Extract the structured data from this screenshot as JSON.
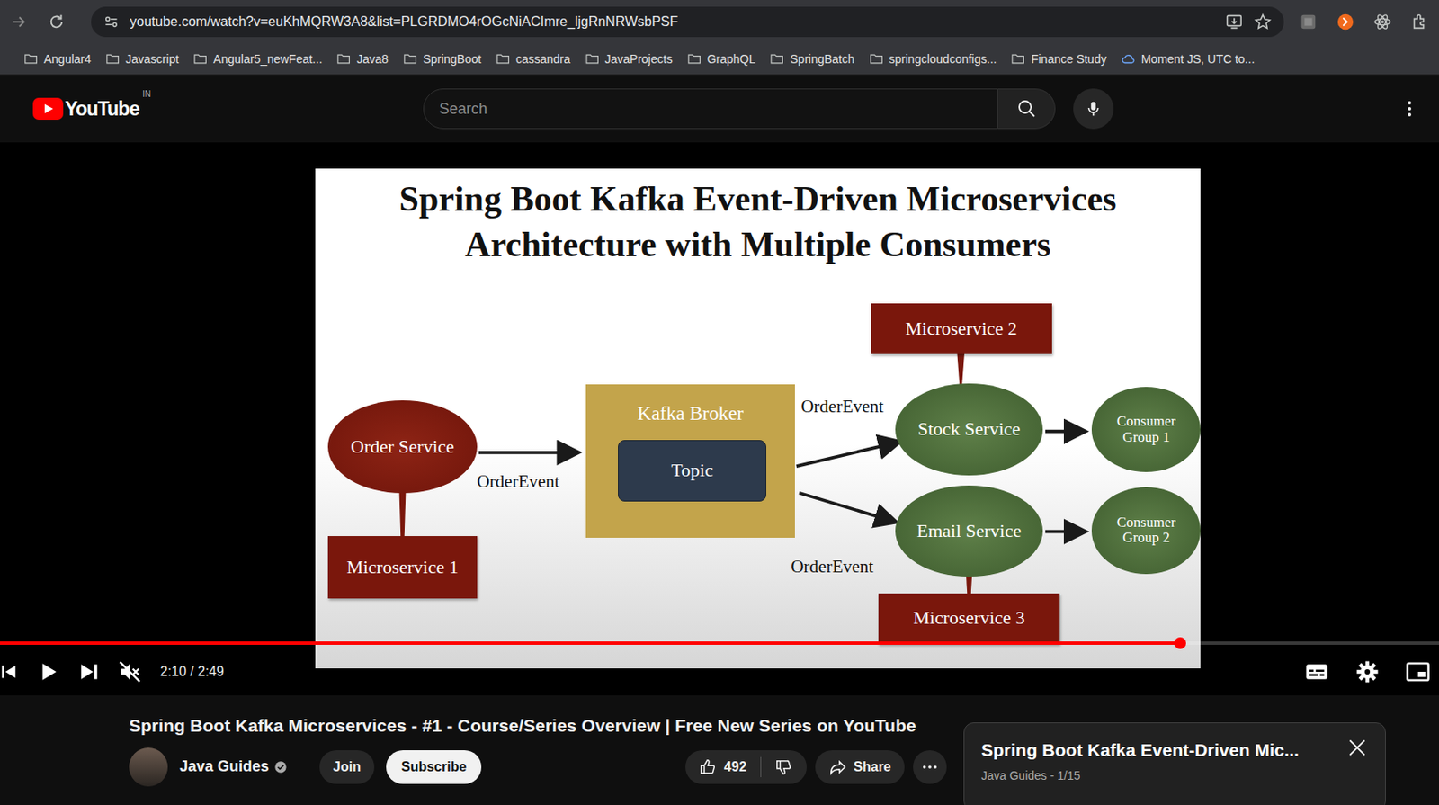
{
  "browser": {
    "url": "youtube.com/watch?v=euKhMQRW3A8&list=PLGRDMO4rOGcNiACImre_ljgRnNRWsbPSF",
    "bookmarks": [
      {
        "label": "Angular4",
        "kind": "folder"
      },
      {
        "label": "Javascript",
        "kind": "folder"
      },
      {
        "label": "Angular5_newFeat...",
        "kind": "folder"
      },
      {
        "label": "Java8",
        "kind": "folder"
      },
      {
        "label": "SpringBoot",
        "kind": "folder"
      },
      {
        "label": "cassandra",
        "kind": "folder"
      },
      {
        "label": "JavaProjects",
        "kind": "folder"
      },
      {
        "label": "GraphQL",
        "kind": "folder"
      },
      {
        "label": "SpringBatch",
        "kind": "folder"
      },
      {
        "label": "springcloudconfigs...",
        "kind": "folder"
      },
      {
        "label": "Finance Study",
        "kind": "folder"
      },
      {
        "label": "Moment JS, UTC to...",
        "kind": "link"
      }
    ]
  },
  "youtube": {
    "logo": "YouTube",
    "region": "IN",
    "search": {
      "placeholder": "Search"
    }
  },
  "slide": {
    "title": [
      "Spring Boot Kafka Event-Driven Microservices",
      "Architecture with Multiple Consumers"
    ],
    "nodes": [
      {
        "label": "Order Service",
        "kind": "producer"
      },
      {
        "label": "Microservice 1",
        "kind": "microservice"
      },
      {
        "label": "Kafka Broker",
        "kind": "broker"
      },
      {
        "label": "Topic",
        "kind": "topic"
      },
      {
        "label": "Microservice 2",
        "kind": "microservice"
      },
      {
        "label": "Stock Service",
        "kind": "consumer"
      },
      {
        "label": "Email Service",
        "kind": "consumer"
      },
      {
        "label": "Consumer Group 1",
        "kind": "group"
      },
      {
        "label": "Consumer Group 2",
        "kind": "group"
      },
      {
        "label": "Microservice 3",
        "kind": "microservice"
      }
    ],
    "labels": [
      "OrderEvent",
      "OrderEvent",
      "OrderEvent"
    ]
  },
  "player": {
    "time": "2:10 / 2:49",
    "level": 0.82,
    "muted": true
  },
  "video": {
    "title": "Spring Boot Kafka Microservices - #1 - Course/Series Overview | Free New Series on YouTube",
    "channel": "Java Guides",
    "verified": true,
    "join": "Join",
    "subscribe": "Subscribe",
    "likes": "492",
    "share": "Share"
  },
  "playlist": {
    "title": "Spring Boot Kafka Event-Driven Mic...",
    "subtitle": "Java Guides - 1/15"
  }
}
